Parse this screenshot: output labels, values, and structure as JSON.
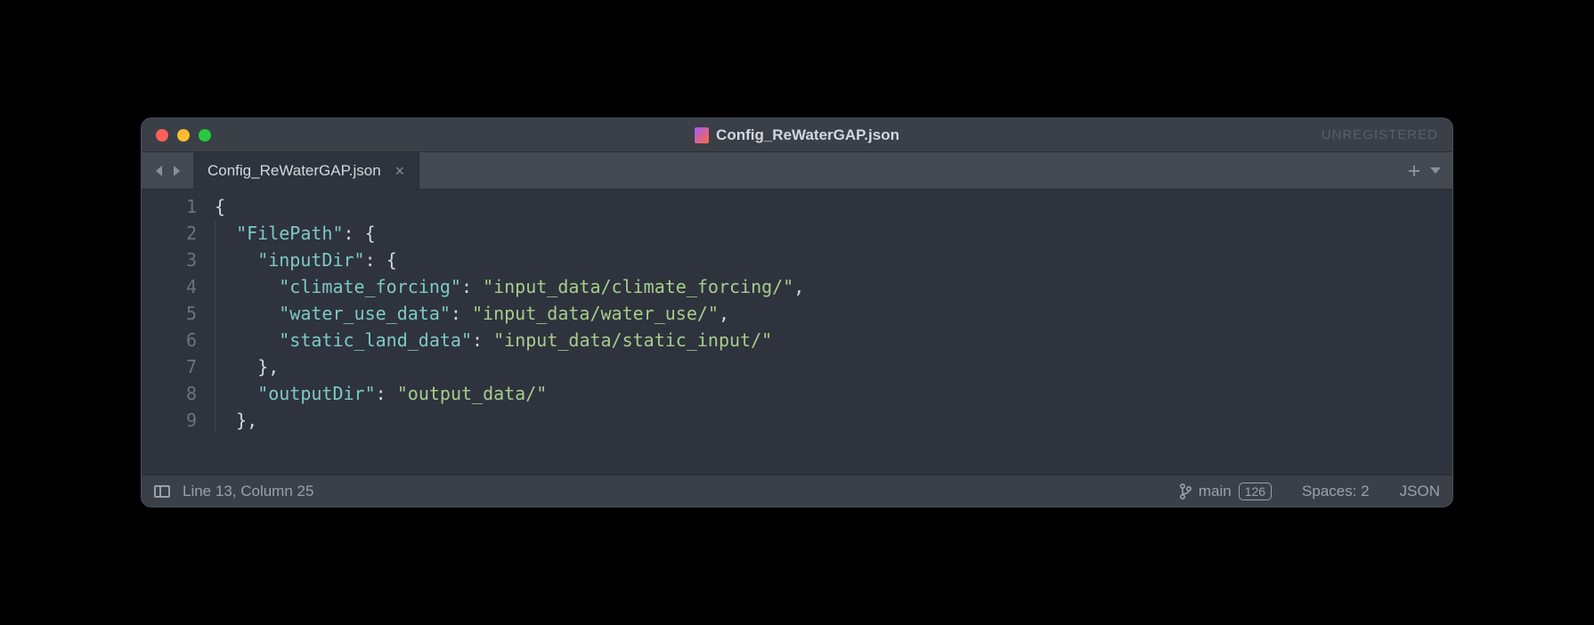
{
  "titlebar": {
    "title": "Config_ReWaterGAP.json",
    "unregistered": "UNREGISTERED"
  },
  "tab": {
    "name": "Config_ReWaterGAP.json"
  },
  "code": {
    "lines": [
      {
        "n": 1,
        "indent": 0,
        "tokens": [
          {
            "t": "punct",
            "v": "{"
          }
        ]
      },
      {
        "n": 2,
        "indent": 1,
        "tokens": [
          {
            "t": "key",
            "v": "\"FilePath\""
          },
          {
            "t": "punct",
            "v": ": {"
          }
        ]
      },
      {
        "n": 3,
        "indent": 1,
        "tokens": [
          {
            "t": "pad",
            "v": "  "
          },
          {
            "t": "key",
            "v": "\"inputDir\""
          },
          {
            "t": "punct",
            "v": ": {"
          }
        ]
      },
      {
        "n": 4,
        "indent": 1,
        "tokens": [
          {
            "t": "pad",
            "v": "    "
          },
          {
            "t": "key",
            "v": "\"climate_forcing\""
          },
          {
            "t": "punct",
            "v": ": "
          },
          {
            "t": "string",
            "v": "\"input_data/climate_forcing/\""
          },
          {
            "t": "punct",
            "v": ","
          }
        ]
      },
      {
        "n": 5,
        "indent": 1,
        "tokens": [
          {
            "t": "pad",
            "v": "    "
          },
          {
            "t": "key",
            "v": "\"water_use_data\""
          },
          {
            "t": "punct",
            "v": ": "
          },
          {
            "t": "string",
            "v": "\"input_data/water_use/\""
          },
          {
            "t": "punct",
            "v": ","
          }
        ]
      },
      {
        "n": 6,
        "indent": 1,
        "tokens": [
          {
            "t": "pad",
            "v": "    "
          },
          {
            "t": "key",
            "v": "\"static_land_data\""
          },
          {
            "t": "punct",
            "v": ": "
          },
          {
            "t": "string",
            "v": "\"input_data/static_input/\""
          }
        ]
      },
      {
        "n": 7,
        "indent": 1,
        "tokens": [
          {
            "t": "pad",
            "v": "  "
          },
          {
            "t": "punct",
            "v": "},"
          }
        ]
      },
      {
        "n": 8,
        "indent": 1,
        "tokens": [
          {
            "t": "pad",
            "v": "  "
          },
          {
            "t": "key",
            "v": "\"outputDir\""
          },
          {
            "t": "punct",
            "v": ": "
          },
          {
            "t": "string",
            "v": "\"output_data/\""
          }
        ]
      },
      {
        "n": 9,
        "indent": 1,
        "tokens": [
          {
            "t": "punct",
            "v": "},"
          }
        ]
      }
    ]
  },
  "status": {
    "position": "Line 13, Column 25",
    "branch_name": "main",
    "branch_count": "126",
    "spaces": "Spaces: 2",
    "syntax": "JSON"
  }
}
